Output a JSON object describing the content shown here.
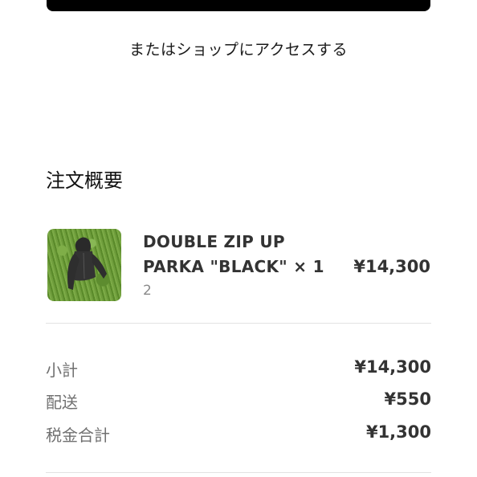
{
  "shop_access_text": "またはショップにアクセスする",
  "order_summary": {
    "title": "注文概要",
    "item": {
      "name": "DOUBLE ZIP UP PARKA \"BLACK\" × 1",
      "variant": "2",
      "price": "¥14,300",
      "image_icon": "parka-thumbnail"
    },
    "rows": [
      {
        "label": "小計",
        "value": "¥14,300"
      },
      {
        "label": "配送",
        "value": "¥550"
      },
      {
        "label": "税金合計",
        "value": "¥1,300"
      }
    ]
  },
  "colors": {
    "accent": "#000000",
    "label_gray": "#707070",
    "divider": "#e2e2e2"
  }
}
